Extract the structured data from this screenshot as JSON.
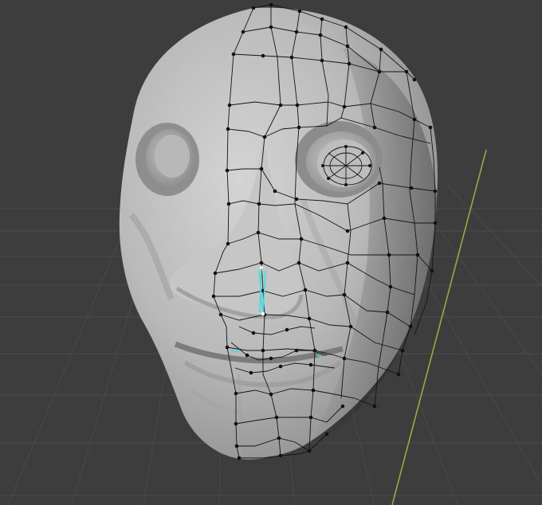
{
  "viewport": {
    "background": "#3d3d3d",
    "grid_color": "#4a4a4a",
    "y_axis_color": "#8fb03a",
    "mesh_surface": "#bdbdbd",
    "mesh_shadow": "#8e8e8e",
    "wire_color": "#111111",
    "selection_color": "#3fe0e0"
  }
}
